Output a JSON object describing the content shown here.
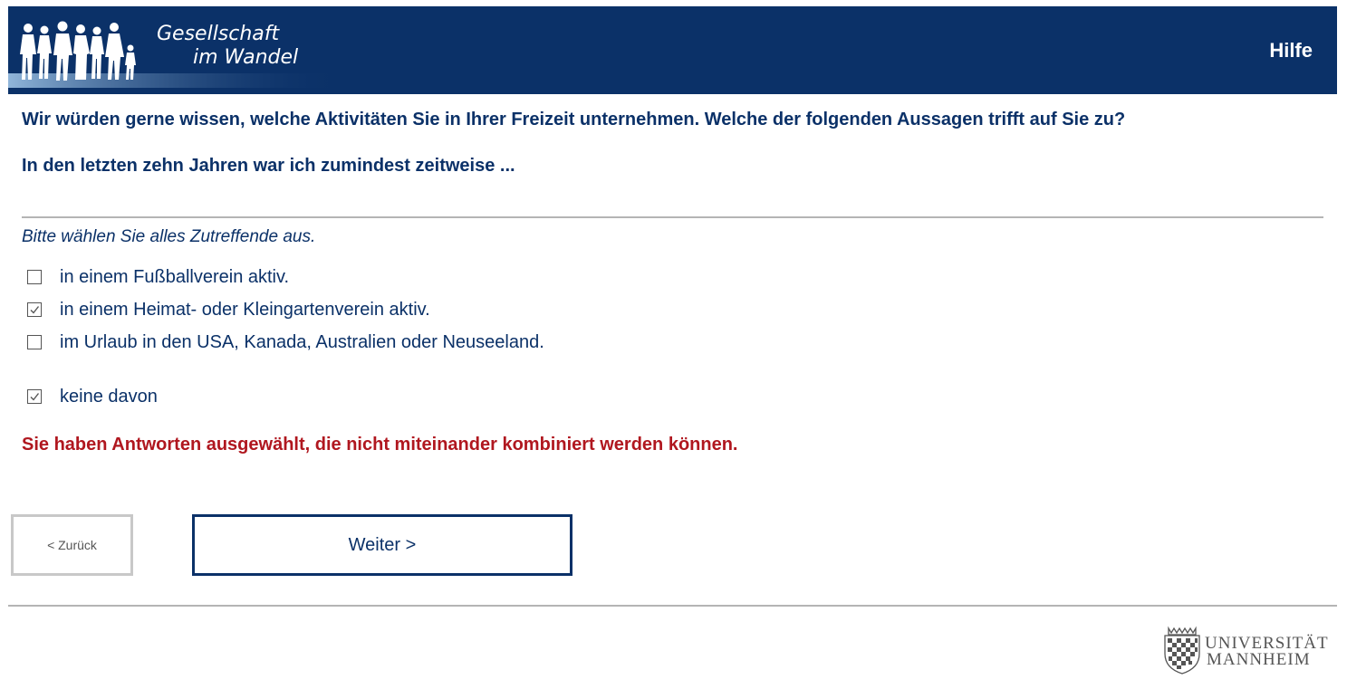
{
  "header": {
    "logo_line1": "Gesellschaft",
    "logo_line2": "im Wandel",
    "help_label": "Hilfe",
    "background_color": "#0b3168"
  },
  "question": {
    "text": "Wir würden gerne wissen, welche Aktivitäten Sie in Ihrer Freizeit unternehmen. Welche der folgenden Aussagen trifft auf Sie zu?",
    "subtext": "In den letzten zehn Jahren war ich zumindest zeitweise ...",
    "instruction": "Bitte wählen Sie alles Zutreffende aus."
  },
  "options": [
    {
      "label": "in einem Fußballverein aktiv.",
      "checked": false
    },
    {
      "label": "in einem Heimat- oder Kleingartenverein aktiv.",
      "checked": true
    },
    {
      "label": "im Urlaub in den USA, Kanada, Australien oder Neuseeland.",
      "checked": false
    },
    {
      "label": "keine davon",
      "checked": true
    }
  ],
  "error": {
    "text": "Sie haben Antworten ausgewählt, die nicht miteinander kombiniert werden können.",
    "color": "#b0171f"
  },
  "navigation": {
    "back_label": "< Zurück",
    "next_label": "Weiter >"
  },
  "footer": {
    "university_line1": "UNIVERSITÄT",
    "university_line2": "MANNHEIM"
  }
}
